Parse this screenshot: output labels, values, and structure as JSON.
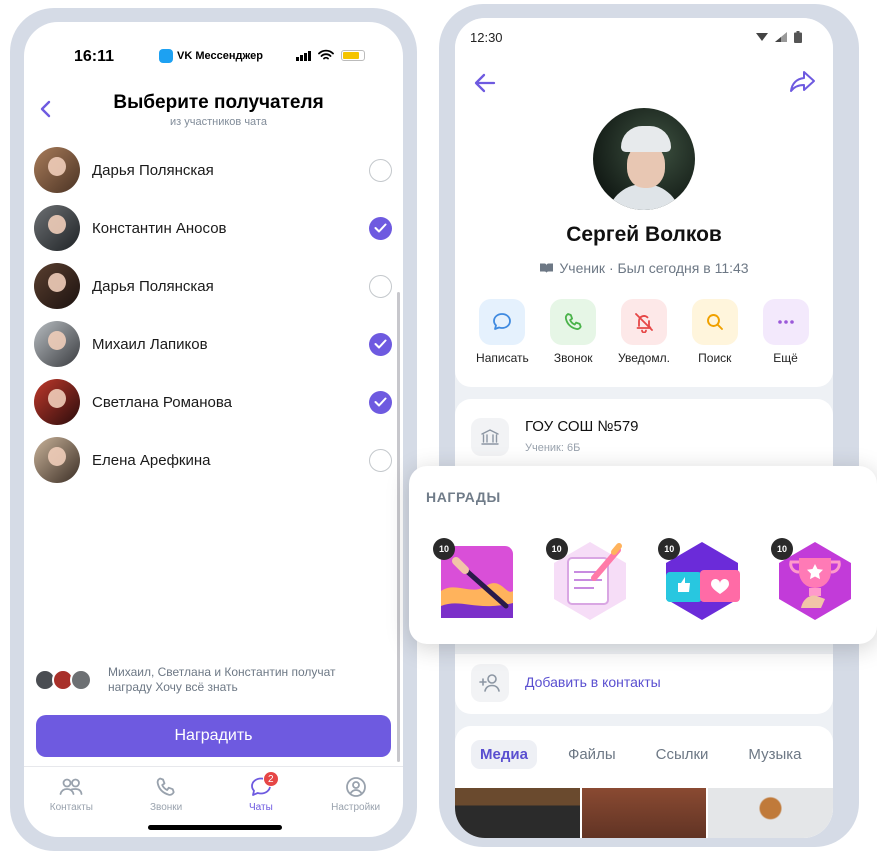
{
  "left_screen": {
    "status_time": "16:11",
    "status_app": "VK Мессенджер",
    "title": "Выберите получателя",
    "subtitle": "из участников чата",
    "contacts": [
      {
        "name": "Дарья Полянская",
        "selected": false
      },
      {
        "name": "Константин Аносов",
        "selected": true
      },
      {
        "name": "Дарья Полянская",
        "selected": false
      },
      {
        "name": "Михаил Лапиков",
        "selected": true
      },
      {
        "name": "Светлана Романова",
        "selected": true
      },
      {
        "name": "Елена Арефкина",
        "selected": false
      }
    ],
    "selection_note": "Михаил, Светлана и Константин получат награду Хочу всё знать",
    "reward_button": "Наградить",
    "tabs": [
      {
        "label": "Контакты",
        "icon": "contacts-icon",
        "active": false
      },
      {
        "label": "Звонки",
        "icon": "phone-icon",
        "active": false
      },
      {
        "label": "Чаты",
        "icon": "chat-icon",
        "active": true,
        "badge": "2"
      },
      {
        "label": "Настройки",
        "icon": "settings-icon",
        "active": false
      }
    ]
  },
  "right_screen": {
    "status_time": "12:30",
    "profile_name": "Сергей Волков",
    "profile_status": "Ученик · Был сегодня в 11:43",
    "actions": [
      {
        "label": "Написать",
        "icon": "message-icon",
        "color": "#3f8ae0",
        "bg": "#e5f1fd"
      },
      {
        "label": "Звонок",
        "icon": "phone-icon",
        "color": "#4bb34b",
        "bg": "#e6f6e6"
      },
      {
        "label": "Уведомл.",
        "icon": "bell-off-icon",
        "color": "#e64646",
        "bg": "#fde8e8"
      },
      {
        "label": "Поиск",
        "icon": "search-icon",
        "color": "#f0a100",
        "bg": "#fff5dc"
      },
      {
        "label": "Ещё",
        "icon": "more-icon",
        "color": "#9b59d9",
        "bg": "#f3e9fc"
      }
    ],
    "school_name": "ГОУ СОШ №579",
    "school_sub": "Ученик: 6Б",
    "add_contact": "Добавить в контакты",
    "media_tabs": [
      {
        "label": "Медиа",
        "active": true
      },
      {
        "label": "Файлы",
        "active": false
      },
      {
        "label": "Ссылки",
        "active": false
      },
      {
        "label": "Музыка",
        "active": false
      }
    ]
  },
  "awards": {
    "title": "НАГРАДЫ",
    "items": [
      {
        "level": "10",
        "icon": "paintbrush-award-icon"
      },
      {
        "level": "10",
        "icon": "notebook-pen-award-icon"
      },
      {
        "level": "10",
        "icon": "cards-like-award-icon"
      },
      {
        "level": "10",
        "icon": "trophy-cup-award-icon"
      }
    ]
  },
  "colors": {
    "accent": "#6e5ae0",
    "link": "#5a4fd0",
    "frame": "#d5dbe6",
    "badge_red": "#e64646"
  }
}
